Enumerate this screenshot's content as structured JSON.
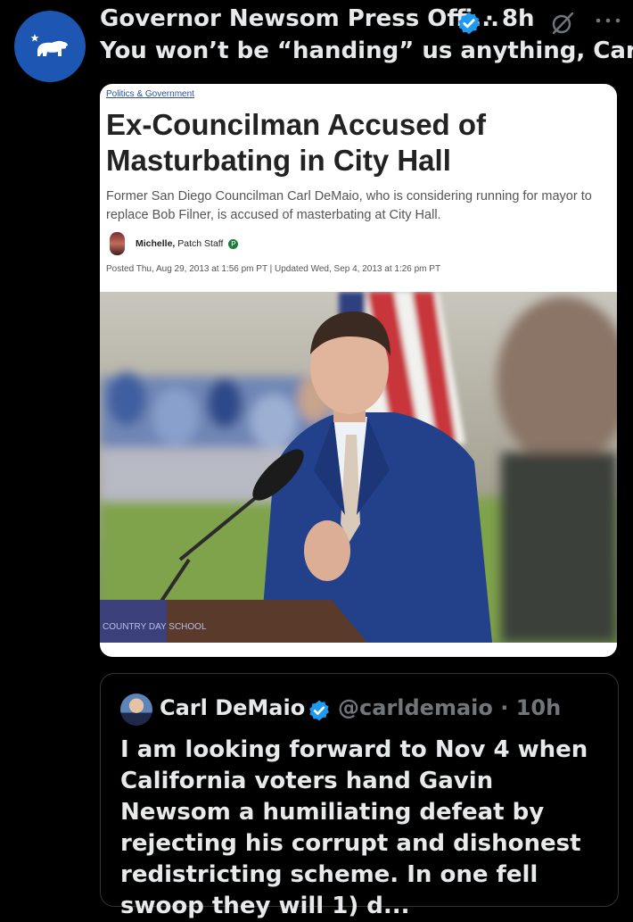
{
  "tweet": {
    "display_name": "Governor Newsom Press Offi...",
    "dot_time": "· 8h",
    "text": "You won’t be “handing” us anything, Carl"
  },
  "article": {
    "category": "Politics & Government",
    "headline": "Ex-Councilman Accused of Masturbating in City Hall",
    "dek": "Former San Diego Councilman Carl DeMaio, who is considering running for mayor to replace Bob Filner, is accused of masterbating at City Hall.",
    "author_name": "Michelle,",
    "author_role": "Patch Staff",
    "patch_badge": "P",
    "posted": "Posted Thu, Aug 29, 2013 at 1:56 pm PT  |  Updated Wed, Sep 4, 2013 at 1:26 pm PT",
    "podium_sign": "COUNTRY DAY SCHOOL"
  },
  "quoted_tweet": {
    "display_name": "Carl DeMaio",
    "handle_time": "@carldemaio · 10h",
    "text": "I am looking forward to Nov 4 when California voters hand Gavin Newsom a humiliating defeat by rejecting his corrupt and dishonest redistricting scheme.  In one fell swoop they will 1) d..."
  },
  "colors": {
    "background": "#000000",
    "avatar_blue": "#1d56b3",
    "verified_blue": "#1d9bf0",
    "link_blue": "#2b4fa5",
    "muted": "#71767b"
  },
  "icons": [
    "california-bear-logo",
    "verified-badge-icon",
    "grok-icon",
    "more-icon"
  ]
}
